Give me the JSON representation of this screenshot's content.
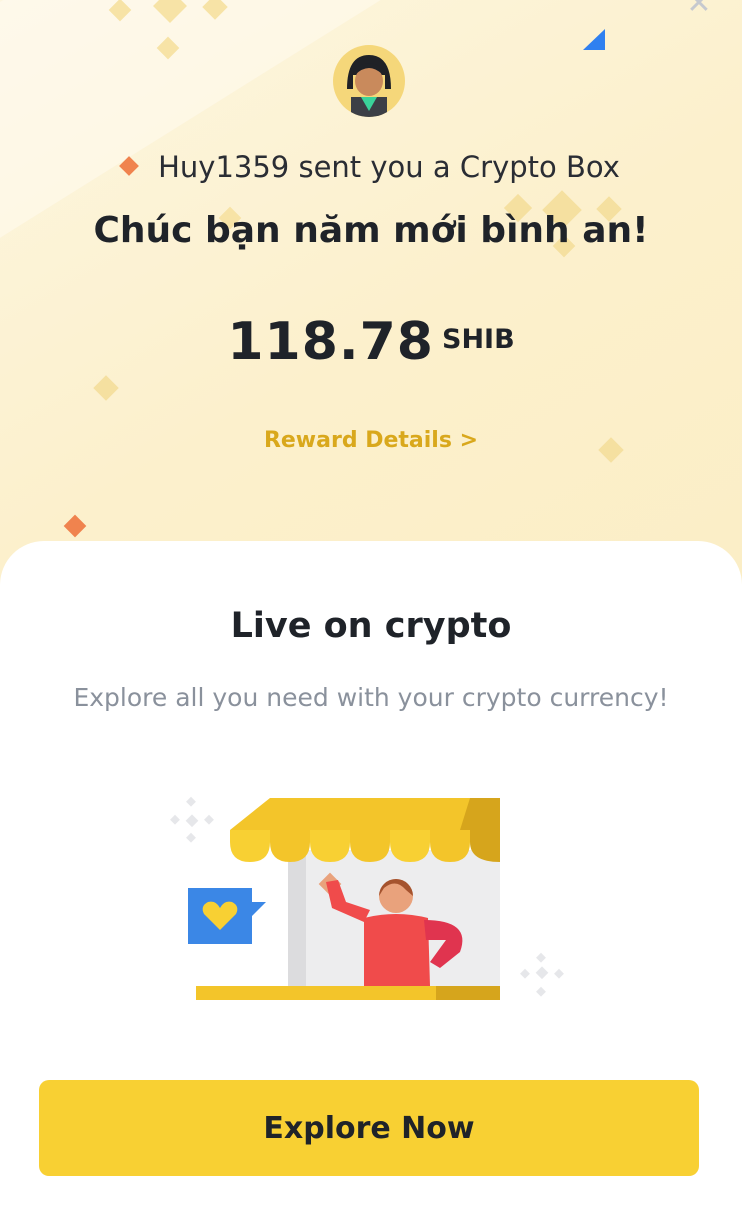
{
  "header": {
    "sender_line": "Huy1359 sent you a Crypto Box",
    "greeting": "Chúc bạn năm mới bình an!",
    "amount": "118.78",
    "currency": "SHIB",
    "reward_link": "Reward Details >"
  },
  "card": {
    "title": "Live on crypto",
    "subtitle": "Explore all you need with your crypto currency!",
    "button_label": "Explore Now"
  },
  "icons": {
    "close": "close-icon",
    "avatar": "user-avatar",
    "illustration": "shop-illustration"
  },
  "colors": {
    "accent": "#f8d033",
    "link": "#d9a81c",
    "bullet": "#f0834e",
    "background": "#fcf0cc"
  }
}
